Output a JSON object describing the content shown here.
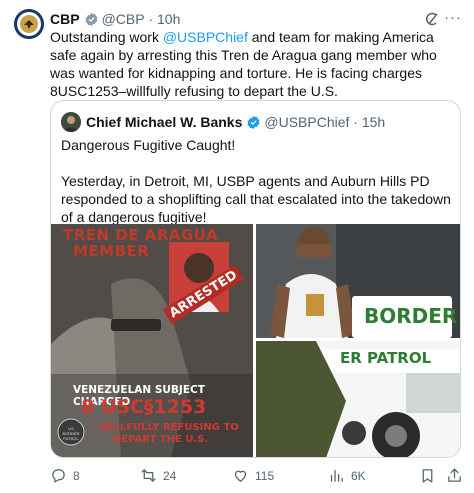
{
  "author": {
    "name": "CBP",
    "handle": "@CBP",
    "time": "10h"
  },
  "post": {
    "text_before": "Outstanding work ",
    "mention": "@USBPChief",
    "text_after": " and team for making America safe again by arresting this Tren de Aragua gang member who was wanted  for kidnapping and torture. He is facing charges 8USC1253–willfully refusing to depart the U.S."
  },
  "quote": {
    "name": "Chief Michael W. Banks",
    "handle": "@USBPChief",
    "time": "15h",
    "line1": "Dangerous Fugitive Caught!",
    "line2": "Yesterday, in Detroit, MI, USBP agents and Auburn Hills PD responded to a shoplifting call that escalated into the takedown of a dangerous fugitive!"
  },
  "media": {
    "img1": {
      "top_text1": "TREN DE ARAGUA",
      "top_text2": "MEMBER",
      "arrested": "ARRESTED",
      "caption1": "VENEZUELAN SUBJECT CHARGED",
      "caption2": "8 USC§1253",
      "caption3": "- WILLFULLY REFUSING TO",
      "caption4": "DEPART THE U.S.",
      "seal": "US BORDER PATROL"
    },
    "img2": {
      "sign": "BORDER"
    },
    "img3": {
      "sign": "ER PATROL"
    }
  },
  "actions": {
    "replies": "8",
    "reposts": "24",
    "likes": "115",
    "views": "6K"
  },
  "colors": {
    "accent": "#1d9bf0",
    "muted": "#536471",
    "border": "#cfd9de"
  },
  "icons": [
    "cbp-seal-icon",
    "verified-badge-icon",
    "grok-icon",
    "more-icon",
    "reply-icon",
    "repost-icon",
    "like-icon",
    "views-icon",
    "bookmark-icon",
    "share-icon"
  ]
}
